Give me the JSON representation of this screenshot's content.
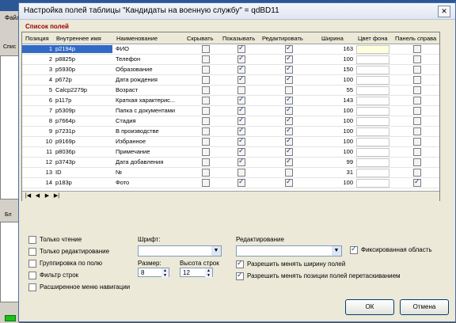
{
  "dialog": {
    "title": "Настройка полей таблицы \"Кандидаты на военную службу\" = qdBD11",
    "close_glyph": "✕",
    "list_label": "Список полей"
  },
  "background": {
    "menu": "Файл",
    "tab_label": "Бл",
    "left_label": "Спис"
  },
  "grid": {
    "headers": {
      "num": "Позиция",
      "name": "Внутреннее имя",
      "title": "Наименование",
      "hide": "Скрывать",
      "show": "Показывать",
      "edit": "Редактировать",
      "width": "Ширина",
      "bg": "Цвет фона",
      "right": "Панель справа"
    },
    "rows": [
      {
        "num": "1",
        "name": "p2194p",
        "title": "ФИО",
        "hide": false,
        "show": true,
        "edit": true,
        "width": "163",
        "right": false
      },
      {
        "num": "2",
        "name": "p8825p",
        "title": "Телефон",
        "hide": false,
        "show": true,
        "edit": true,
        "width": "100",
        "right": false
      },
      {
        "num": "3",
        "name": "p5930p",
        "title": "Образование",
        "hide": false,
        "show": true,
        "edit": true,
        "width": "150",
        "right": false
      },
      {
        "num": "4",
        "name": "p672p",
        "title": "Дата рождения",
        "hide": false,
        "show": true,
        "edit": true,
        "width": "100",
        "right": false
      },
      {
        "num": "5",
        "name": "Calcp2279p",
        "title": "Возраст",
        "hide": false,
        "show": false,
        "edit": false,
        "width": "55",
        "right": false
      },
      {
        "num": "6",
        "name": "p117p",
        "title": "Краткая характерис...",
        "hide": false,
        "show": true,
        "edit": true,
        "width": "143",
        "right": false
      },
      {
        "num": "7",
        "name": "p5309p",
        "title": "Папка с документами",
        "hide": false,
        "show": true,
        "edit": true,
        "width": "100",
        "right": false
      },
      {
        "num": "8",
        "name": "p7664p",
        "title": "Стадия",
        "hide": false,
        "show": true,
        "edit": true,
        "width": "100",
        "right": false
      },
      {
        "num": "9",
        "name": "p7231p",
        "title": "В производстве",
        "hide": false,
        "show": true,
        "edit": true,
        "width": "100",
        "right": false
      },
      {
        "num": "10",
        "name": "p9169p",
        "title": "Избранное",
        "hide": false,
        "show": true,
        "edit": true,
        "width": "100",
        "right": false
      },
      {
        "num": "11",
        "name": "p8036p",
        "title": "Примечание",
        "hide": false,
        "show": true,
        "edit": true,
        "width": "100",
        "right": false
      },
      {
        "num": "12",
        "name": "p3743p",
        "title": "Дата добавления",
        "hide": false,
        "show": true,
        "edit": true,
        "width": "99",
        "right": false
      },
      {
        "num": "13",
        "name": "ID",
        "title": "№",
        "hide": false,
        "show": false,
        "edit": false,
        "width": "31",
        "right": false
      },
      {
        "num": "14",
        "name": "p183p",
        "title": "Фото",
        "hide": false,
        "show": true,
        "edit": true,
        "width": "100",
        "right": true
      }
    ]
  },
  "options": {
    "readonly": "Только чтение",
    "editonly": "Только редактирование",
    "grouping": "Группировка по полю",
    "filter": "Фильтр строк",
    "extnav": "Расширенное меню навигации",
    "font_label": "Шрифт:",
    "size_label": "Размер:",
    "size_value": "8",
    "rowheight_label": "Высота строк",
    "rowheight_value": "12",
    "edit_label": "Редактирование",
    "fixed_area": "Фиксированная область",
    "allow_width": "Разрешить менять ширину полей",
    "allow_move": "Разрешить менять позиции полей перетаскиванием"
  },
  "buttons": {
    "ok": "ОК",
    "cancel": "Отмена"
  },
  "nav": {
    "first": "|◀",
    "prev": "◀",
    "next": "▶",
    "last": "▶|"
  }
}
